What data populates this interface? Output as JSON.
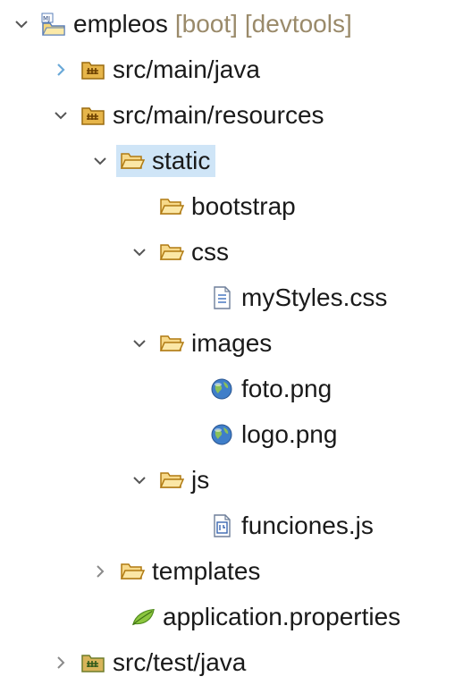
{
  "project": {
    "name": "empleos",
    "decorations": [
      "[boot]",
      "[devtools]"
    ]
  },
  "tree": [
    {
      "label": "empleos",
      "icon": "project-icon",
      "expanded": true
    },
    {
      "label": "src/main/java",
      "icon": "source-folder-icon",
      "expanded": false
    },
    {
      "label": "src/main/resources",
      "icon": "source-folder-icon",
      "expanded": true
    },
    {
      "label": "static",
      "icon": "folder-icon",
      "expanded": true,
      "selected": true
    },
    {
      "label": "bootstrap",
      "icon": "folder-icon"
    },
    {
      "label": "css",
      "icon": "folder-icon",
      "expanded": true
    },
    {
      "label": "myStyles.css",
      "icon": "css-file-icon"
    },
    {
      "label": "images",
      "icon": "folder-icon",
      "expanded": true
    },
    {
      "label": "foto.png",
      "icon": "image-file-icon"
    },
    {
      "label": "logo.png",
      "icon": "image-file-icon"
    },
    {
      "label": "js",
      "icon": "folder-icon",
      "expanded": true
    },
    {
      "label": "funciones.js",
      "icon": "js-file-icon"
    },
    {
      "label": "templates",
      "icon": "folder-icon",
      "expanded": false
    },
    {
      "label": "application.properties",
      "icon": "properties-file-icon"
    },
    {
      "label": "src/test/java",
      "icon": "source-folder-icon",
      "expanded": false
    }
  ],
  "colors": {
    "selection": "#cfe5f7",
    "twisty": "#6aa9d8",
    "folder": "#d9a33a",
    "decoration": "#9a8a6a"
  }
}
